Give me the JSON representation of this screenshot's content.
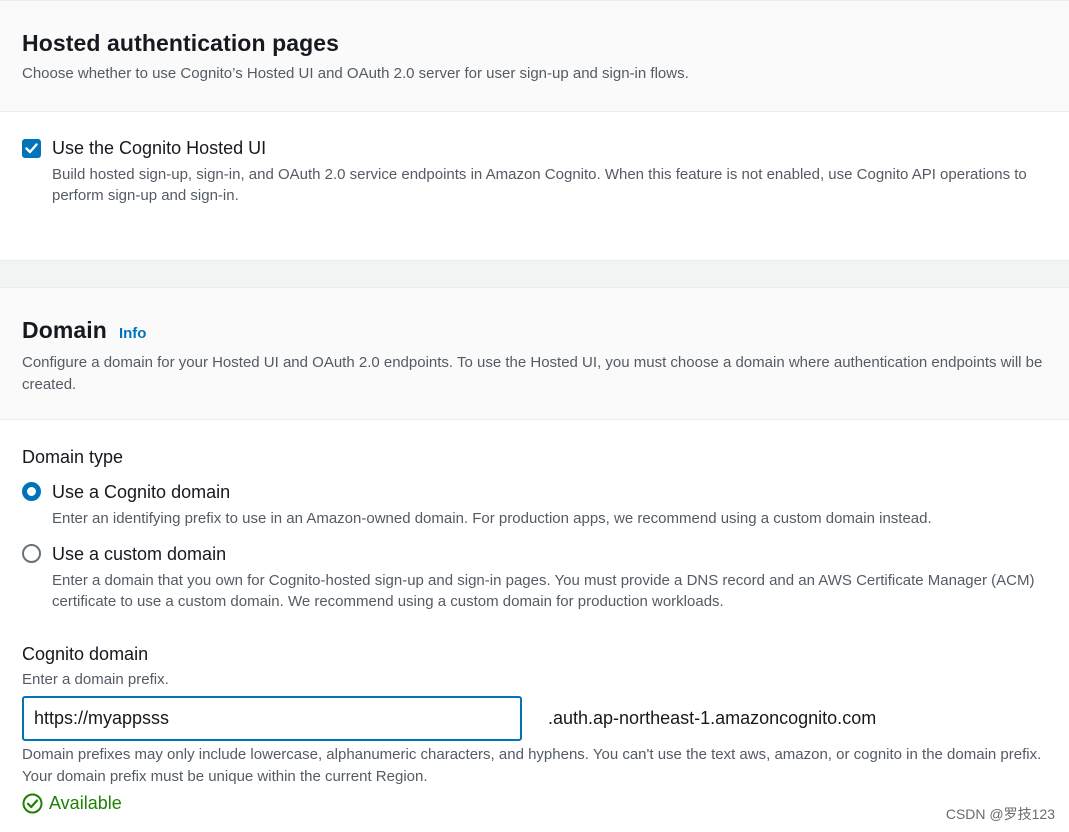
{
  "hosted_ui": {
    "title": "Hosted authentication pages",
    "description": "Choose whether to use Cognito’s Hosted UI and OAuth 2.0 server for user sign-up and sign-in flows.",
    "checkbox_label": "Use the Cognito Hosted UI",
    "checkbox_checked": true,
    "checkbox_description": "Build hosted sign-up, sign-in, and OAuth 2.0 service endpoints in Amazon Cognito. When this feature is not enabled, use Cognito API operations to perform sign-up and sign-in."
  },
  "domain": {
    "title": "Domain",
    "info_link": "Info",
    "description": "Configure a domain for your Hosted UI and OAuth 2.0 endpoints. To use the Hosted UI, you must choose a domain where authentication endpoints will be created.",
    "type_label": "Domain type",
    "options": [
      {
        "label": "Use a Cognito domain",
        "description": "Enter an identifying prefix to use in an Amazon-owned domain. For production apps, we recommend using a custom domain instead.",
        "selected": true
      },
      {
        "label": "Use a custom domain",
        "description": "Enter a domain that you own for Cognito-hosted sign-up and sign-in pages. You must provide a DNS record and an AWS Certificate Manager (ACM) certificate to use a custom domain. We recommend using a custom domain for production workloads.",
        "selected": false
      }
    ],
    "field_label": "Cognito domain",
    "field_hint": "Enter a domain prefix.",
    "input_value": "https://myappsss",
    "suffix": ".auth.ap-northeast-1.amazoncognito.com",
    "constraint": "Domain prefixes may only include lowercase, alphanumeric characters, and hyphens. You can't use the text aws, amazon, or cognito in the domain prefix. Your domain prefix must be unique within the current Region.",
    "status": "Available"
  },
  "colors": {
    "accent": "#0073bb",
    "success": "#1d8102",
    "text": "#16191f",
    "muted": "#545b64"
  },
  "watermark": "CSDN @罗技123"
}
